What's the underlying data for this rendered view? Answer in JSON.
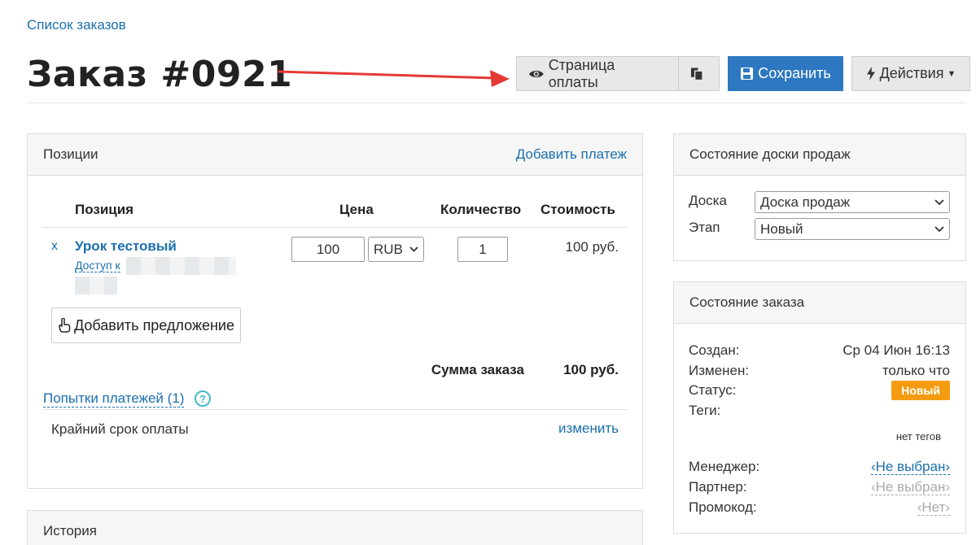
{
  "breadcrumb": "Список заказов",
  "page_title": "Заказ #0921",
  "toolbar": {
    "pay_page": "Страница оплаты",
    "save": "Сохранить",
    "actions": "Действия"
  },
  "positions": {
    "title": "Позиции",
    "add_payment": "Добавить платеж",
    "columns": {
      "item": "Позиция",
      "price": "Цена",
      "qty": "Количество",
      "cost": "Стоимость"
    },
    "row": {
      "remove": "x",
      "name": "Урок тестовый",
      "access": "Доступ к",
      "price": "100",
      "currency": "RUB",
      "qty": "1",
      "cost": "100 руб."
    },
    "add_offer": "Добавить предложение",
    "sum_label": "Сумма заказа",
    "sum_value": "100 руб.",
    "attempts": "Попытки платежей (1)",
    "help": "?",
    "deadline_label": "Крайний срок оплаты",
    "deadline_change": "изменить"
  },
  "history": {
    "title": "История"
  },
  "board": {
    "title": "Состояние доски продаж",
    "board_label": "Доска",
    "board_value": "Доска продаж",
    "stage_label": "Этап",
    "stage_value": "Новый"
  },
  "order_state": {
    "title": "Состояние заказа",
    "created_label": "Создан:",
    "created_value": "Ср 04 Июн 16:13",
    "changed_label": "Изменен:",
    "changed_value": "только что",
    "status_label": "Статус:",
    "status_value": "Новый",
    "status_color": "#f39c12",
    "tags_label": "Теги:",
    "tags_value": "нет тегов",
    "manager_label": "Менеджер:",
    "manager_value": "‹Не выбран›",
    "partner_label": "Партнер:",
    "partner_value": "‹Не выбран›",
    "promo_label": "Промокод:",
    "promo_value": "‹Нет›"
  }
}
